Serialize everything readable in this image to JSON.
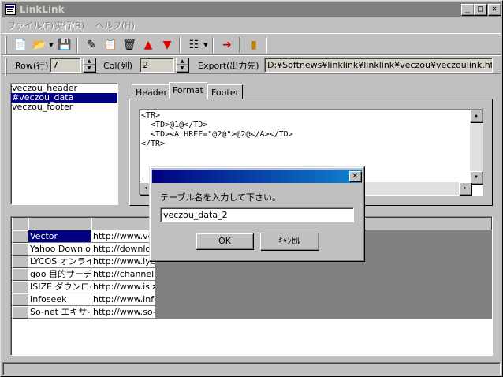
{
  "window": {
    "title": "LinkLink"
  },
  "title_buttons": {
    "minimize": "_",
    "maximize": "□",
    "close": "✕"
  },
  "menu": [
    {
      "label": "ファイル(F)"
    },
    {
      "label": "実行(R)"
    },
    {
      "label": "ヘルプ(H)"
    }
  ],
  "toolbar": {
    "tools": [
      {
        "name": "new-file",
        "glyph": "📄"
      },
      {
        "name": "open-folder",
        "glyph": "📂"
      },
      {
        "name": "save-disk",
        "glyph": "💾"
      },
      {
        "name": "edit-pen",
        "glyph": "✎"
      },
      {
        "name": "copy-page",
        "glyph": "📋"
      },
      {
        "name": "delete-trash",
        "glyph": "🗑"
      },
      {
        "name": "move-up-arrow",
        "glyph": "▲"
      },
      {
        "name": "move-down-arrow",
        "glyph": "▼"
      },
      {
        "name": "list-tree",
        "glyph": "☷"
      },
      {
        "name": "export-arrow",
        "glyph": "➜"
      },
      {
        "name": "exit-door",
        "glyph": "▮"
      }
    ],
    "dropdown_glyph": "▼",
    "colors": {
      "up_arrow": "#e00000",
      "down_arrow": "#e00000",
      "exit_door": "#c08000"
    }
  },
  "params": {
    "row_label": "Row(行)",
    "row_value": "7",
    "col_label": "Col(列)",
    "col_value": "2",
    "export_label": "Export(出力先)",
    "export_path": "D:¥Softnews¥linklink¥linklink¥veczou¥veczoulink.html",
    "spin_up": "▲",
    "spin_down": "▼"
  },
  "sections": [
    {
      "label": "veczou_header",
      "selected": false
    },
    {
      "label": "#veczou_data",
      "selected": true
    },
    {
      "label": "veczou_footer",
      "selected": false
    }
  ],
  "tabs": [
    {
      "label": "Header",
      "active": false
    },
    {
      "label": "Format",
      "active": true
    },
    {
      "label": "Footer",
      "active": false
    }
  ],
  "editor": {
    "lines": [
      "<TR>",
      "  <TD>@1@</TD>",
      "  <TD><A HREF=\"@2@\">@2@</A></TD>",
      "</TR>"
    ],
    "scroll_up": "▲",
    "scroll_down": "▼",
    "scroll_left": "◀",
    "scroll_right": "▶"
  },
  "grid": {
    "rows": [
      {
        "name": "Vector",
        "url": "http://www.ve",
        "selected": true
      },
      {
        "name": "Yahoo Downloa",
        "url": "http://downlo",
        "selected": false
      },
      {
        "name": "LYCOS オンライ",
        "url": "http://www.lyc",
        "selected": false
      },
      {
        "name": "goo 目的サーチ",
        "url": "http://channel.",
        "selected": false
      },
      {
        "name": "ISIZE ダウンロ-",
        "url": "http://www.isiz",
        "selected": false
      },
      {
        "name": "Infoseek",
        "url": "http://www.info",
        "selected": false
      },
      {
        "name": "So-net エキサ-",
        "url": "http://www.so-",
        "selected": false
      }
    ],
    "colors": {
      "selection": "#000080"
    }
  },
  "dialog": {
    "prompt": "テーブル名を入力して下さい。",
    "input_value": "veczou_data_2",
    "ok_label": "OK",
    "cancel_label": "ｷｬﾝｾﾙ",
    "close_glyph": "✕"
  }
}
